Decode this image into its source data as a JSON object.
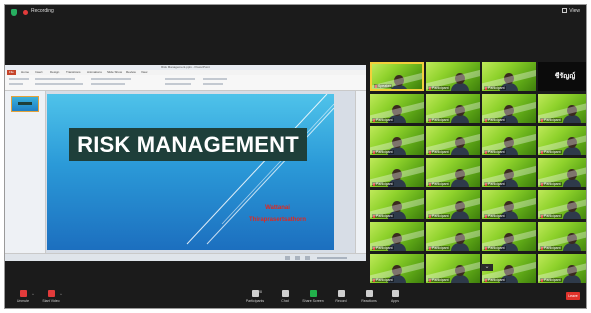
{
  "topbar": {
    "recording_label": "Recording",
    "view_label": "View"
  },
  "presentation": {
    "window_title": "Risk Management.pptx - PowerPoint",
    "tabs": [
      "File",
      "Home",
      "Insert",
      "Design",
      "Transitions",
      "Animations",
      "Slide Show",
      "Review",
      "View"
    ],
    "slide_title": "RISK MANAGEMENT",
    "author_line1": "Wattanai",
    "author_line2": "Thiraprasertsathorn"
  },
  "gallery": {
    "participants": [
      {
        "name": "Speaker"
      },
      {
        "name": "Participant"
      },
      {
        "name": "Participant"
      },
      {
        "name": "ชีรัญญ์",
        "big": true
      },
      {
        "name": "Participant"
      },
      {
        "name": "Participant"
      },
      {
        "name": "Participant"
      },
      {
        "name": "Participant"
      },
      {
        "name": "Participant"
      },
      {
        "name": "Participant"
      },
      {
        "name": "Participant"
      },
      {
        "name": "Participant"
      },
      {
        "name": "Participant"
      },
      {
        "name": "Participant"
      },
      {
        "name": "Participant"
      },
      {
        "name": "Participant"
      },
      {
        "name": "Participant"
      },
      {
        "name": "Participant"
      },
      {
        "name": "Participant"
      },
      {
        "name": "Participant"
      },
      {
        "name": "Participant"
      },
      {
        "name": "Participant"
      },
      {
        "name": "Participant"
      },
      {
        "name": "Participant"
      },
      {
        "name": "Participant"
      },
      {
        "name": "Participant"
      },
      {
        "name": "Participant"
      },
      {
        "name": "Participant"
      }
    ]
  },
  "toolbar": {
    "unmute": "Unmute",
    "start_video": "Start Video",
    "participants": "Participants",
    "participants_count": "28",
    "chat": "Chat",
    "share_screen": "Share Screen",
    "record": "Record",
    "reactions": "Reactions",
    "apps": "Apps",
    "end": "Leave"
  },
  "colors": {
    "tile_green": "#8fd22c",
    "speaker_border": "#f2d03b",
    "share_green": "#22b04b",
    "end_red": "#e0322b",
    "slide_title_bg": "#1e3f3a"
  }
}
